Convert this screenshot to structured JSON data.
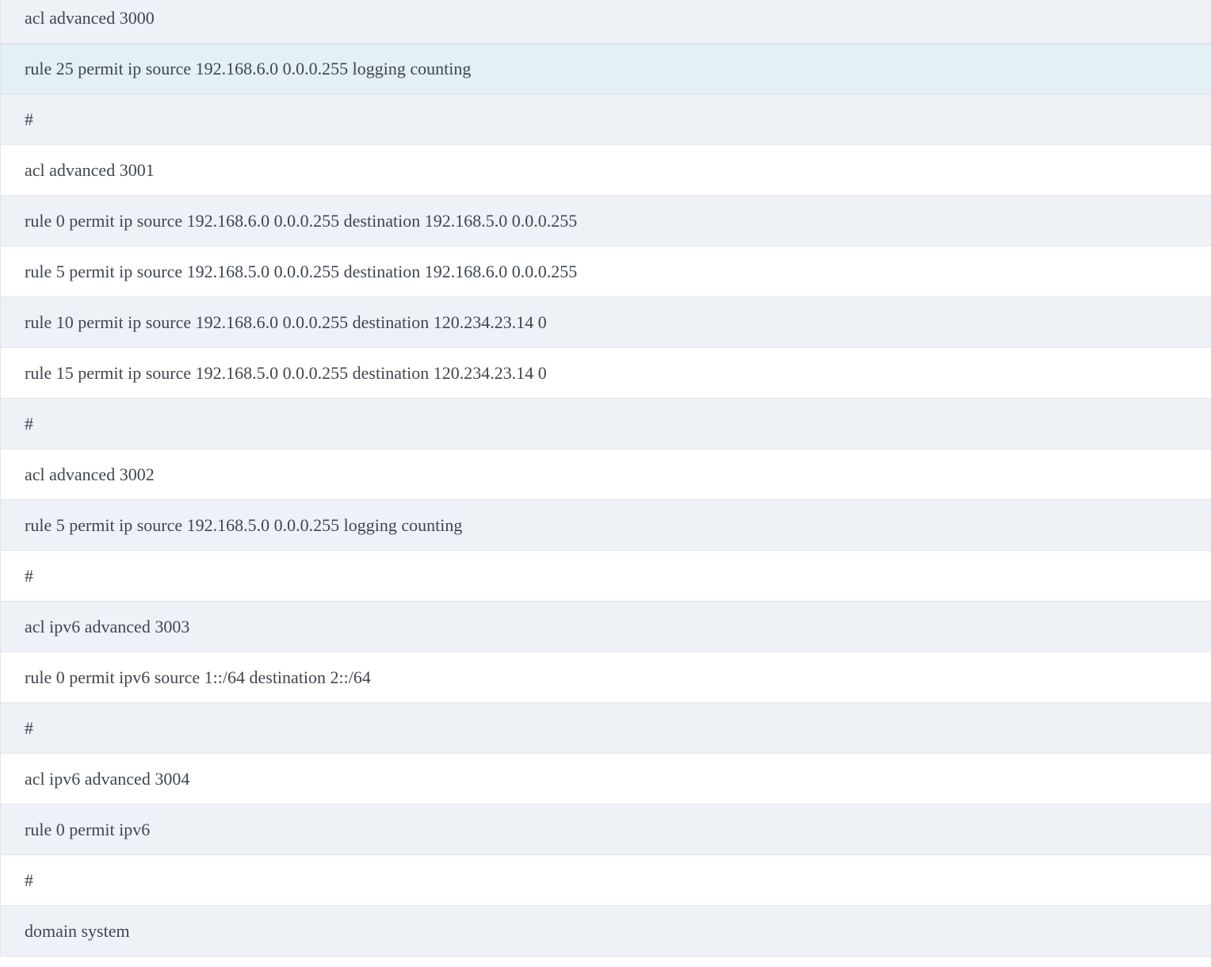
{
  "config_lines": [
    {
      "text": "acl advanced 3000",
      "state": "odd"
    },
    {
      "text": "rule 25 permit ip source 192.168.6.0 0.0.0.255 logging counting",
      "state": "selected"
    },
    {
      "text": "#",
      "state": "odd"
    },
    {
      "text": "acl advanced 3001",
      "state": "even"
    },
    {
      "text": "rule 0 permit ip source 192.168.6.0 0.0.0.255 destination 192.168.5.0 0.0.0.255",
      "state": "odd"
    },
    {
      "text": "rule 5 permit ip source 192.168.5.0 0.0.0.255 destination 192.168.6.0 0.0.0.255",
      "state": "even"
    },
    {
      "text": "rule 10 permit ip source 192.168.6.0 0.0.0.255 destination 120.234.23.14 0",
      "state": "odd"
    },
    {
      "text": "rule 15 permit ip source 192.168.5.0 0.0.0.255 destination 120.234.23.14 0",
      "state": "even"
    },
    {
      "text": "#",
      "state": "odd"
    },
    {
      "text": "acl advanced 3002",
      "state": "even"
    },
    {
      "text": "rule 5 permit ip source 192.168.5.0 0.0.0.255 logging counting",
      "state": "odd"
    },
    {
      "text": "#",
      "state": "even"
    },
    {
      "text": "acl ipv6 advanced 3003",
      "state": "odd"
    },
    {
      "text": "rule 0 permit ipv6 source 1::/64 destination 2::/64",
      "state": "even"
    },
    {
      "text": "#",
      "state": "odd"
    },
    {
      "text": "acl ipv6 advanced 3004",
      "state": "even"
    },
    {
      "text": "rule 0 permit ipv6",
      "state": "odd"
    },
    {
      "text": "#",
      "state": "even"
    },
    {
      "text": "domain system",
      "state": "odd"
    }
  ]
}
